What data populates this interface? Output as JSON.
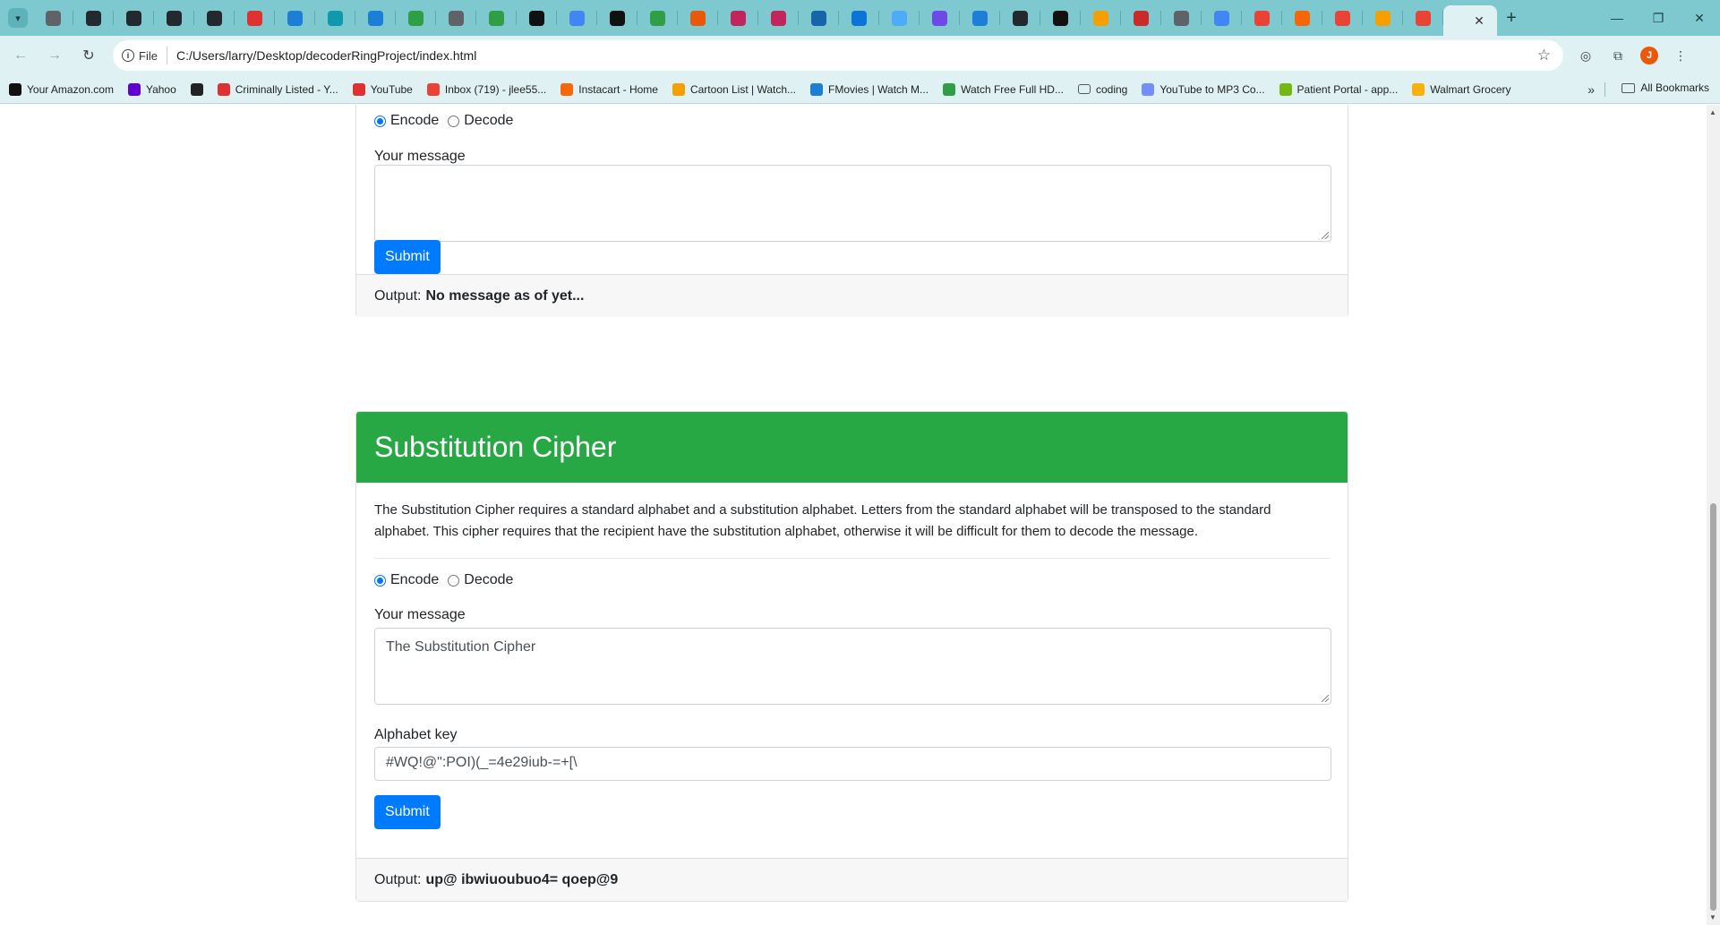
{
  "browser": {
    "tabs": [
      {
        "icon": "tab-icon-generic",
        "color": "#5f6368"
      },
      {
        "icon": "github-icon",
        "color": "#24292f"
      },
      {
        "icon": "github-icon",
        "color": "#24292f"
      },
      {
        "icon": "github-icon",
        "color": "#24292f"
      },
      {
        "icon": "github-icon",
        "color": "#24292f"
      },
      {
        "icon": "tab-icon-red",
        "color": "#e03131"
      },
      {
        "icon": "tab-icon-blue",
        "color": "#1c7ed6"
      },
      {
        "icon": "tab-icon-cyan",
        "color": "#1098ad"
      },
      {
        "icon": "tab-icon-blue",
        "color": "#1c7ed6"
      },
      {
        "icon": "tab-icon-w",
        "color": "#2f9e44"
      },
      {
        "icon": "tab-icon-generic",
        "color": "#5f6368"
      },
      {
        "icon": "tab-icon-w",
        "color": "#2f9e44"
      },
      {
        "icon": "tab-icon-codepen",
        "color": "#111111"
      },
      {
        "icon": "google-icon",
        "color": "#4285f4"
      },
      {
        "icon": "tab-icon-dark",
        "color": "#111111"
      },
      {
        "icon": "tab-icon-w",
        "color": "#2f9e44"
      },
      {
        "icon": "tab-icon-star",
        "color": "#e8590c"
      },
      {
        "icon": "tab-icon-m",
        "color": "#c2255c"
      },
      {
        "icon": "tab-icon-m",
        "color": "#c2255c"
      },
      {
        "icon": "tab-icon-fx",
        "color": "#1864ab"
      },
      {
        "icon": "outlook-icon",
        "color": "#0b74d6"
      },
      {
        "icon": "tab-icon-ring",
        "color": "#4dabf7"
      },
      {
        "icon": "tab-icon-purple",
        "color": "#7048e8"
      },
      {
        "icon": "tab-icon-ring",
        "color": "#1c7ed6"
      },
      {
        "icon": "github-icon",
        "color": "#24292f"
      },
      {
        "icon": "tab-icon-dark",
        "color": "#111111"
      },
      {
        "icon": "tab-icon-pen",
        "color": "#f59f00"
      },
      {
        "icon": "tab-icon-red",
        "color": "#c92a2a"
      },
      {
        "icon": "tab-icon-generic",
        "color": "#5f6368"
      },
      {
        "icon": "google-icon",
        "color": "#4285f4"
      },
      {
        "icon": "gmail-icon",
        "color": "#ea4335"
      },
      {
        "icon": "tab-icon-orange",
        "color": "#f76707"
      },
      {
        "icon": "gmail-icon",
        "color": "#ea4335"
      },
      {
        "icon": "tab-icon-pen",
        "color": "#f59f00"
      },
      {
        "icon": "gmail-icon",
        "color": "#ea4335"
      }
    ],
    "address": {
      "scheme_label": "File",
      "url": "C:/Users/larry/Desktop/decoderRingProject/index.html"
    },
    "profile_initial": "J",
    "bookmarks": [
      {
        "label": "Your Amazon.com",
        "color": "#111111"
      },
      {
        "label": "Yahoo",
        "color": "#6001d2"
      },
      {
        "label": "",
        "color": "#222222"
      },
      {
        "label": "Criminally Listed - Y...",
        "color": "#e03131"
      },
      {
        "label": "YouTube",
        "color": "#e03131"
      },
      {
        "label": "Inbox (719) - jlee55...",
        "color": "#ea4335"
      },
      {
        "label": "Instacart - Home",
        "color": "#f76707"
      },
      {
        "label": "Cartoon List | Watch...",
        "color": "#f59f00"
      },
      {
        "label": "FMovies | Watch M...",
        "color": "#1c7ed6"
      },
      {
        "label": "Watch Free Full HD...",
        "color": "#2f9e44"
      },
      {
        "label": "coding",
        "color": "#555555"
      },
      {
        "label": "YouTube to MP3 Co...",
        "color": "#748ffc"
      },
      {
        "label": "Patient Portal - app...",
        "color": "#74b816"
      },
      {
        "label": "Walmart Grocery",
        "color": "#fab005"
      }
    ],
    "all_bookmarks_label": "All Bookmarks"
  },
  "caesar": {
    "encode_label": "Encode",
    "decode_label": "Decode",
    "message_label": "Your message",
    "message_value": "",
    "submit_label": "Submit",
    "output_prefix": "Output:",
    "output_value": "No message as of yet..."
  },
  "substitution": {
    "title": "Substitution Cipher",
    "description": "The Substitution Cipher requires a standard alphabet and a substitution alphabet. Letters from the standard alphabet will be transposed to the standard alphabet. This cipher requires that the recipient have the substitution alphabet, otherwise it will be difficult for them to decode the message.",
    "encode_label": "Encode",
    "decode_label": "Decode",
    "message_label": "Your message",
    "message_value": "The Substitution Cipher",
    "key_label": "Alphabet key",
    "key_value": "#WQ!@\":POI)(_=4e29iub-=+[\\",
    "submit_label": "Submit",
    "output_prefix": "Output:",
    "output_value": "up@ ibwiuoubuo4= qoep@9"
  },
  "colors": {
    "header_green": "#28a745",
    "button_blue": "#007bff",
    "chrome_teal": "#7ec8cf"
  }
}
